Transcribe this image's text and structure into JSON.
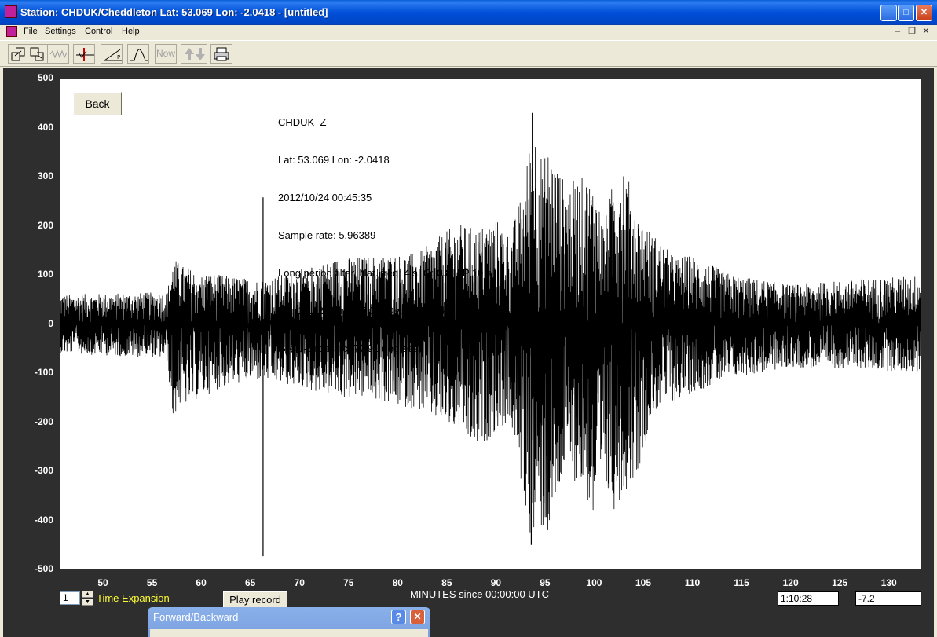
{
  "window": {
    "title": "Station: CHDUK/Cheddleton Lat: 53.069 Lon: -2.0418 - [untitled]",
    "minimize": "_",
    "maximize": "□",
    "close": "✕"
  },
  "menu": {
    "items": [
      "File",
      "Settings",
      "Control",
      "Help"
    ],
    "mdi_minimize": "–",
    "mdi_restore": "❐",
    "mdi_close": "✕"
  },
  "toolbar": {
    "buttons": [
      "open-icon",
      "save-icon",
      "waveform-icon",
      "marker-icon",
      "pick-icon",
      "peak-icon",
      "now-button",
      "up-down-icon",
      "print-icon"
    ],
    "now_label": "Now"
  },
  "back_label": "Back",
  "info_lines": [
    "CHDUK  Z",
    "Lat: 53.069 Lon: -2.0418",
    "2012/10/24 00:45:35",
    "Sample rate: 5.96389",
    "Long period filter. Nat. freq: 4 s, Q: 0.8, LP 10 s",
    "Lat: 10.12, Lon: -85.35, Depth: 39.5 km",
    "Great-circle arc: 77.91 degrees"
  ],
  "chart_data": {
    "type": "line",
    "xlabel": "MINUTES since 00:00:00 UTC",
    "ylabel": "",
    "xlim": [
      45.6,
      133.3
    ],
    "ylim": [
      -500,
      500
    ],
    "x_ticks": [
      "50",
      "55",
      "60",
      "65",
      "70",
      "75",
      "80",
      "85",
      "90",
      "95",
      "100",
      "105",
      "110",
      "115",
      "120",
      "125",
      "130"
    ],
    "y_ticks": [
      "500",
      "400",
      "300",
      "200",
      "100",
      "0",
      "-100",
      "-200",
      "-300",
      "-400",
      "-500"
    ],
    "envelope": {
      "x": [
        45.6,
        56.5,
        57.2,
        58.0,
        60.0,
        62.0,
        64.0,
        66.0,
        70.0,
        74.0,
        78.0,
        82.0,
        86.0,
        88.0,
        90.0,
        91.5,
        93.0,
        93.7,
        94.5,
        95.5,
        97.0,
        99.0,
        100.0,
        101.0,
        102.0,
        103.0,
        104.5,
        106.0,
        108.0,
        110.0,
        114.0,
        120.0,
        126.0,
        133.3
      ],
      "max": [
        60,
        65,
        135,
        120,
        105,
        100,
        95,
        90,
        110,
        135,
        140,
        145,
        205,
        195,
        215,
        180,
        300,
        430,
        350,
        360,
        290,
        300,
        290,
        200,
        300,
        345,
        220,
        185,
        140,
        140,
        100,
        80,
        90,
        100
      ],
      "min": [
        -60,
        -70,
        -210,
        -170,
        -150,
        -130,
        -120,
        -115,
        -130,
        -150,
        -160,
        -175,
        -220,
        -260,
        -220,
        -200,
        -380,
        -450,
        -420,
        -440,
        -300,
        -340,
        -420,
        -350,
        -380,
        -345,
        -300,
        -180,
        -160,
        -140,
        -110,
        -90,
        -90,
        -100
      ]
    },
    "spikes": [
      {
        "x": 66.3,
        "value": 258
      },
      {
        "x": 66.3,
        "value": -473
      },
      {
        "x": 93.7,
        "value": 430
      },
      {
        "x": 93.6,
        "value": -450
      }
    ]
  },
  "bottom": {
    "expansion_value": "1",
    "expansion_label": "Time Expansion",
    "play_label": "Play record",
    "time_readout": "1:10:28",
    "value_readout": "-7.2",
    "spin_up": "▲",
    "spin_down": "▼"
  },
  "dialog": {
    "title": "Forward/Backward",
    "help": "?",
    "close": "✕"
  }
}
